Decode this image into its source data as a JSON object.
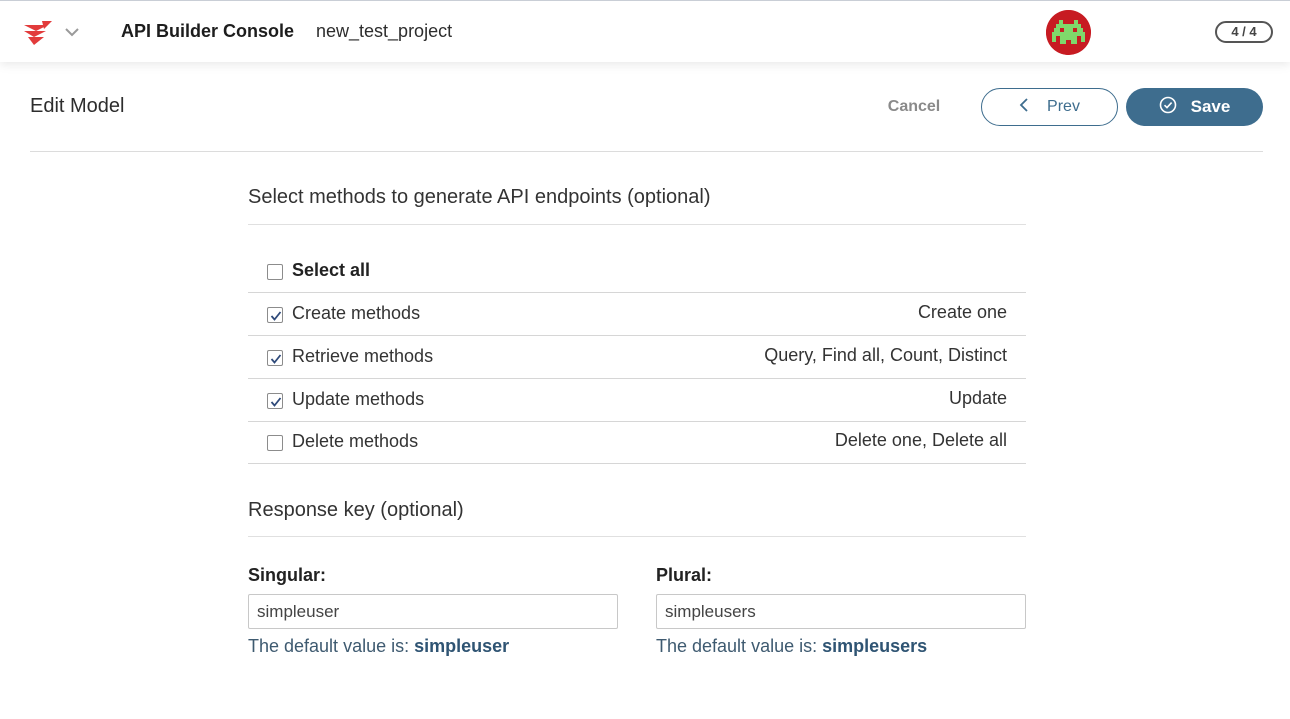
{
  "topbar": {
    "app_title": "API Builder Console",
    "project_name": "new_test_project",
    "step_badge": "4 / 4",
    "logo_icon": "axway-logo-icon",
    "avatar_icon": "space-invader-avatar",
    "brand_color": "#e23b3b"
  },
  "header": {
    "title": "Edit Model",
    "cancel_label": "Cancel",
    "prev_label": "Prev",
    "save_label": "Save",
    "accent_color": "#3e6d8e"
  },
  "methods": {
    "title": "Select methods to generate API endpoints (optional)",
    "select_all": {
      "label": "Select all",
      "checked": false
    },
    "items": [
      {
        "label": "Create methods",
        "desc": "Create one",
        "checked": true
      },
      {
        "label": "Retrieve methods",
        "desc": "Query, Find all, Count, Distinct",
        "checked": true
      },
      {
        "label": "Update methods",
        "desc": "Update",
        "checked": true
      },
      {
        "label": "Delete methods",
        "desc": "Delete one, Delete all",
        "checked": false
      }
    ]
  },
  "response_key": {
    "title": "Response key (optional)",
    "singular": {
      "label": "Singular:",
      "value": "simpleuser",
      "help_prefix": "The default value is:",
      "help_value": "simpleuser"
    },
    "plural": {
      "label": "Plural:",
      "value": "simpleusers",
      "help_prefix": "The default value is:",
      "help_value": "simpleusers"
    }
  }
}
